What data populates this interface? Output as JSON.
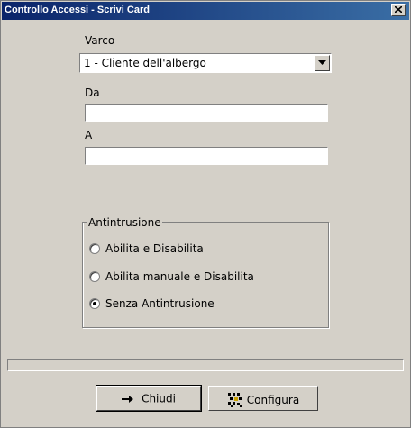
{
  "window": {
    "title": "Controllo Accessi - Scrivi Card",
    "close_icon": "close-icon"
  },
  "varco": {
    "label": "Varco",
    "selected": "1 - Cliente dell'albergo"
  },
  "da": {
    "label": "Da",
    "value": ""
  },
  "a": {
    "label": "A",
    "value": ""
  },
  "antintrusione": {
    "legend": "Antintrusione",
    "options": [
      {
        "label": "Abilita e Disabilita",
        "checked": false
      },
      {
        "label": "Abilita manuale e Disabilita",
        "checked": false
      },
      {
        "label": "Senza Antintrusione",
        "checked": true
      }
    ]
  },
  "buttons": {
    "chiudi": {
      "label": "Chiudi",
      "icon": "arrow-right-icon"
    },
    "configura": {
      "label": "Configura",
      "icon": "configure-icon"
    }
  }
}
